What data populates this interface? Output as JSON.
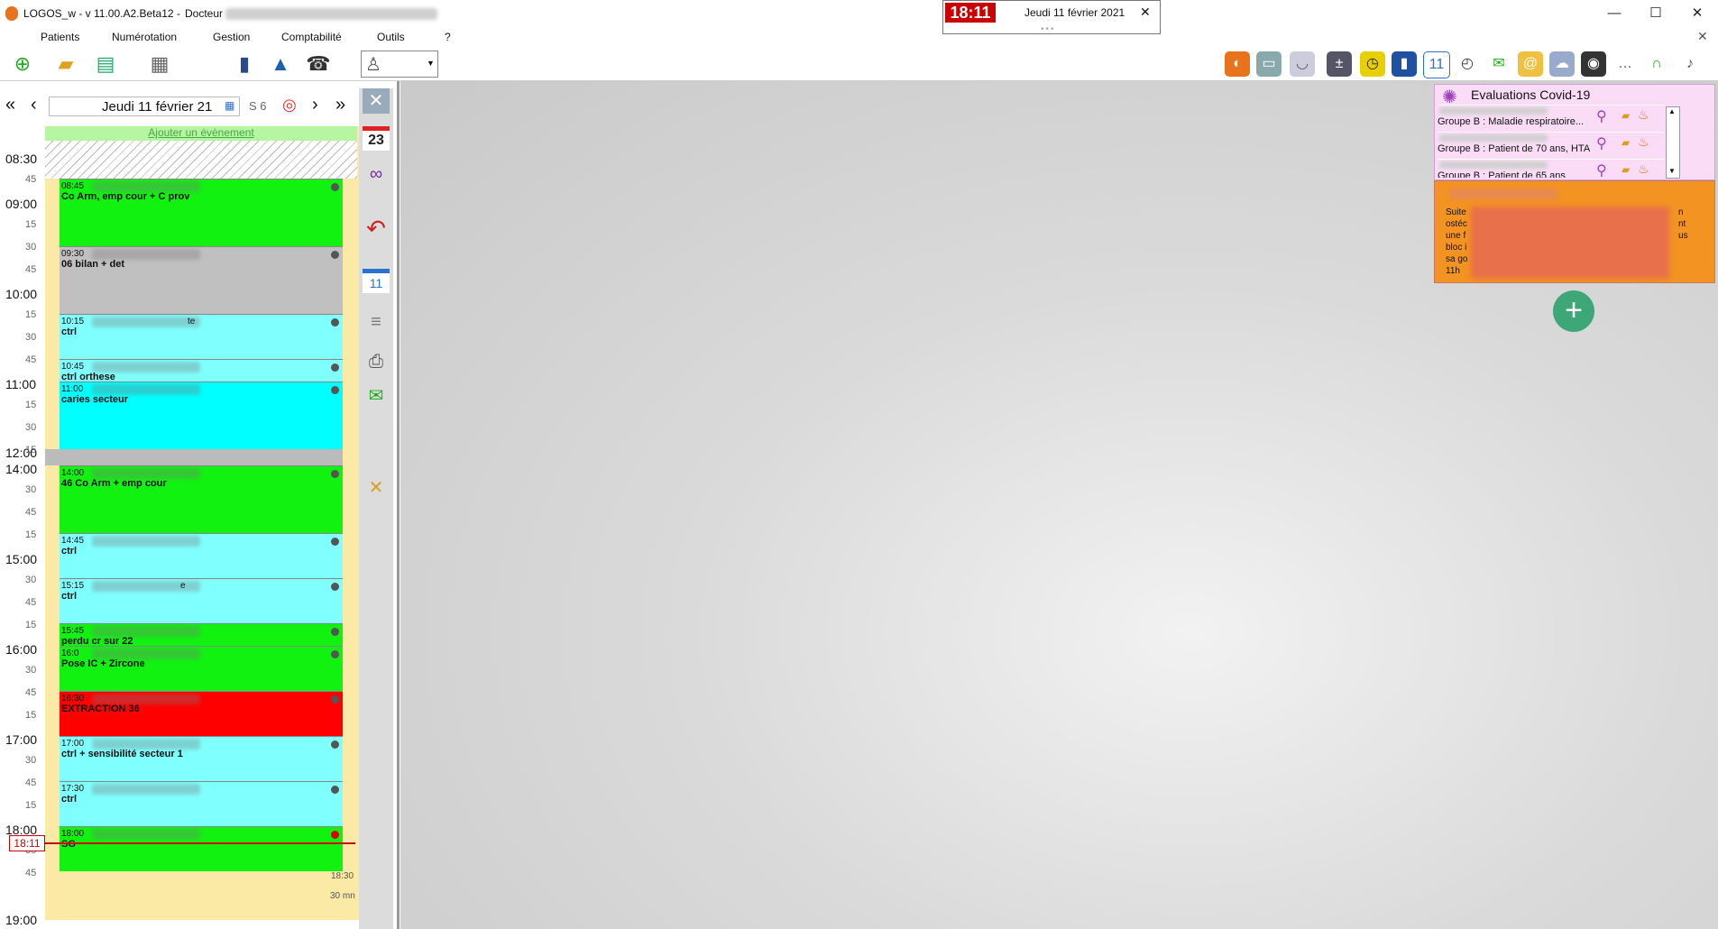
{
  "window": {
    "title": "LOGOS_w - v 11.00.A2.Beta12  -",
    "doctor_label": "Docteur",
    "minimize": "—",
    "maximize": "☐",
    "close": "✕"
  },
  "clock": {
    "time": "18:11",
    "date": "Jeudi 11 février 2021"
  },
  "menu": [
    "Patients",
    "Numérotation",
    "Gestion",
    "Comptabilité",
    "Outils",
    "?"
  ],
  "agenda": {
    "date_display": "Jeudi 11 février 21",
    "week_label": "S 6",
    "add_event": "Ajouter un évènement",
    "now_time": "18:11",
    "end_time": "18:30",
    "duration": "30 mn",
    "hours": [
      "08:30",
      "09:00",
      "10:00",
      "11:00",
      "12:00",
      "14:00",
      "15:00",
      "16:00",
      "17:00",
      "18:00",
      "19:00"
    ],
    "quarter_marks": [
      "45",
      "15",
      "30",
      "45",
      "15",
      "30",
      "45",
      "15",
      "30",
      "15",
      "30",
      "45",
      "15",
      "30",
      "45",
      "15",
      "30",
      "45",
      "15",
      "30",
      "45",
      "15",
      "30",
      "45"
    ],
    "appointments": [
      {
        "time": "08:45",
        "label": "Co Arm, emp cour + C prov",
        "color": "#11f211"
      },
      {
        "time": "09:30",
        "label": "06          bilan + det",
        "color": "#c0c0c0"
      },
      {
        "time": "10:15",
        "label": "ctrl",
        "color": "#80ffff",
        "suffix": "te"
      },
      {
        "time": "10:45",
        "label": "ctrl orthese",
        "color": "#80ffff"
      },
      {
        "time": "11:00",
        "label": "caries secteur",
        "color": "#00ffff"
      },
      {
        "time": "14:00",
        "label": "46 Co Arm + emp cour",
        "color": "#11f211"
      },
      {
        "time": "14:45",
        "label": "ctrl",
        "color": "#80ffff"
      },
      {
        "time": "15:15",
        "label": "ctrl",
        "color": "#80ffff",
        "suffix": "e"
      },
      {
        "time": "15:45",
        "label": "perdu cr sur 22",
        "color": "#11f211"
      },
      {
        "time": "16:0",
        "label": "Pose IC + Zircone",
        "color": "#11f211"
      },
      {
        "time": "16:30",
        "label": "EXTRACTION 36",
        "color": "#ff0000"
      },
      {
        "time": "17:00",
        "label": "ctrl + sensibilité secteur 1",
        "color": "#80ffff"
      },
      {
        "time": "17:30",
        "label": "ctrl",
        "color": "#80ffff"
      },
      {
        "time": "18:00",
        "label": "SG",
        "color": "#11f211"
      }
    ]
  },
  "sidebar": {
    "calendar_day": "23",
    "calendar_day2": "11"
  },
  "covid": {
    "title": "Evaluations Covid-19",
    "rows": [
      "Groupe B : Maladie respiratoire...",
      "Groupe B : Patient de 70 ans, HTA",
      "Groupe B : Patient de 65 ans"
    ]
  },
  "note": {
    "lines": [
      "Suite",
      "ostéc",
      "une f",
      "bloc i",
      "sa go",
      "11h"
    ],
    "right_bits": [
      "n",
      "nt",
      "",
      "us"
    ]
  },
  "colors": {
    "accent_green": "#3ea778",
    "clock_red": "#cc0000",
    "note_orange": "#f39321",
    "covid_pink": "#fadcf6"
  }
}
